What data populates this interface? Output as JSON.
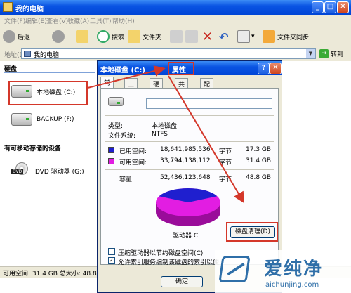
{
  "window": {
    "title": "我的电脑"
  },
  "menu": [
    "文件(F)",
    "编辑(E)",
    "查看(V)",
    "收藏(A)",
    "工具(T)",
    "帮助(H)"
  ],
  "toolbar": {
    "back": "后退",
    "search": "搜索",
    "folders": "文件夹",
    "sync": "文件夹同步"
  },
  "address": {
    "label": "地址(D)",
    "value": "我的电脑",
    "go": "转到"
  },
  "groups": {
    "hard_disks": "硬盘",
    "removable": "有可移动存储的设备"
  },
  "drives": [
    {
      "label": "本地磁盘 (C:)"
    },
    {
      "label": "BACKUP (F:)"
    },
    {
      "label": "DVD 驱动器 (G:)"
    }
  ],
  "status": {
    "text": "可用空间: 31.4 GB 总大小: 48.8"
  },
  "dialog": {
    "title_drive": "本地磁盘 (C:)",
    "title_suffix": "属性",
    "help": "?",
    "close": "✕",
    "tabs": [
      "常规",
      "工具",
      "硬件",
      "共享",
      "配额"
    ],
    "type_label": "类型:",
    "type_value": "本地磁盘",
    "fs_label": "文件系统:",
    "fs_value": "NTFS",
    "used_label": "已用空间:",
    "used_bytes": "18,641,985,536",
    "used_unit": "字节",
    "used_gb": "17.3 GB",
    "free_label": "可用空间:",
    "free_bytes": "33,794,138,112",
    "free_unit": "字节",
    "free_gb": "31.4 GB",
    "cap_label": "容量:",
    "cap_bytes": "52,436,123,648",
    "cap_unit": "字节",
    "cap_gb": "48.8 GB",
    "drive_caption": "驱动器 C",
    "cleanup_button": "磁盘清理(D)",
    "compress_label": "压缩驱动器以节约磁盘空间(C)",
    "index_label": "允许索引服务编制该磁盘的索引以便",
    "ok_button": "确定",
    "used_fraction": 0.355,
    "colors": {
      "used": "#1F1FCF",
      "free": "#E21DE2"
    }
  },
  "watermark": {
    "cn": "爱纯净",
    "en": "aichunjing.com"
  }
}
